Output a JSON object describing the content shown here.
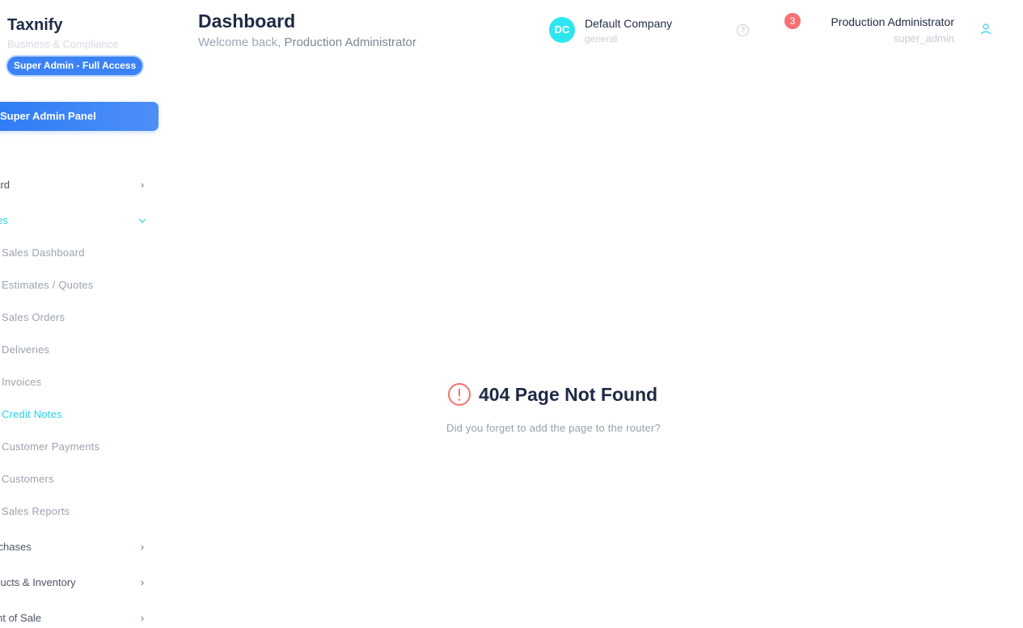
{
  "sidebar": {
    "brand_name": "Taxnify",
    "tagline": "Business & Compliance",
    "role_badge": "Super Admin - Full Access",
    "admin_panel_label": "Super Admin Panel",
    "nav": [
      {
        "label": "oard",
        "chevron": "chevron-right"
      },
      {
        "label": "ales",
        "chevron": "chevron-down",
        "active": true
      },
      {
        "label": "urchases",
        "chevron": "chevron-right"
      },
      {
        "label": "oducts & Inventory",
        "chevron": "chevron-right"
      },
      {
        "label": "oint of Sale",
        "chevron": "chevron-right"
      }
    ],
    "sales_sub": [
      "Sales Dashboard",
      "Estimates / Quotes",
      "Sales Orders",
      "Deliveries",
      "Invoices",
      "Credit Notes",
      "Customer Payments",
      "Customers",
      "Sales Reports"
    ],
    "active_sub": "Credit Notes"
  },
  "header": {
    "title": "Dashboard",
    "welcome_prefix": "Welcome back,",
    "welcome_user": "Production Administrator",
    "company_initials": "DC",
    "company_name": "Default Company",
    "company_type": "general",
    "help_glyph": "?",
    "notification_count": "3",
    "user_name": "Production Administrator",
    "user_role": "super_admin"
  },
  "error": {
    "title": "404 Page Not Found",
    "message": "Did you forget to add the page to the router?"
  },
  "colors": {
    "accent": "#3b82f6",
    "active_cyan": "#22d3ee",
    "badge_red": "#f87171"
  }
}
